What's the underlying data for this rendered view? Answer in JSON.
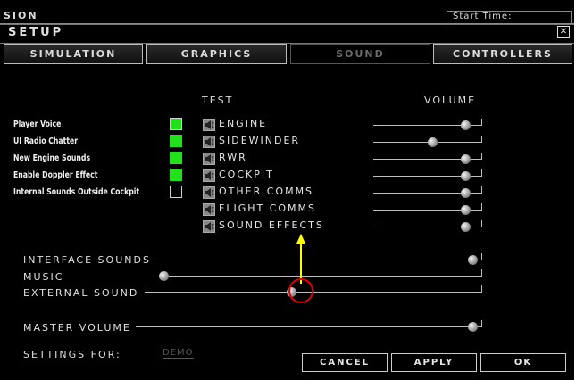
{
  "window": {
    "partial_title": "SION",
    "start_time_label": "Start Time:",
    "setup_title": "SETUP",
    "close_glyph": "✕"
  },
  "tabs": [
    {
      "label": "SIMULATION",
      "active": false
    },
    {
      "label": "GRAPHICS",
      "active": false
    },
    {
      "label": "SOUND",
      "active": true
    },
    {
      "label": "CONTROLLERS",
      "active": false
    }
  ],
  "headers": {
    "test": "TEST",
    "volume": "VOLUME"
  },
  "options": [
    {
      "label": "Player Voice",
      "checked": true
    },
    {
      "label": "UI Radio Chatter",
      "checked": true
    },
    {
      "label": "New Engine Sounds",
      "checked": true
    },
    {
      "label": "Enable Doppler Effect",
      "checked": true
    },
    {
      "label": "Internal Sounds Outside Cockpit",
      "checked": false
    }
  ],
  "channels": [
    {
      "label": "ENGINE",
      "level": 0.92
    },
    {
      "label": "SIDEWINDER",
      "level": 0.58
    },
    {
      "label": "RWR",
      "level": 0.92
    },
    {
      "label": "COCKPIT",
      "level": 0.92
    },
    {
      "label": "OTHER COMMS",
      "level": 0.92
    },
    {
      "label": "FLIGHT COMMS",
      "level": 0.92
    },
    {
      "label": "SOUND EFFECTS",
      "level": 0.92
    }
  ],
  "master_sliders": [
    {
      "label": "INTERFACE SOUNDS",
      "level": 1.0
    },
    {
      "label": "MUSIC",
      "level": 0.0
    },
    {
      "label": "EXTERNAL SOUND",
      "level": 0.44
    },
    {
      "label": "MASTER VOLUME",
      "level": 1.0
    }
  ],
  "settings_for": {
    "label": "SETTINGS FOR:",
    "value": "DEMO"
  },
  "buttons": {
    "cancel": "CANCEL",
    "apply": "APPLY",
    "ok": "OK"
  },
  "annotation": {
    "highlight_target": "EXTERNAL SOUND",
    "arrow_color": "#ffff00",
    "circle_color": "#e00000"
  },
  "colors": {
    "checked": "#22e01a",
    "background": "#000000",
    "text": "#e0e0e0"
  }
}
